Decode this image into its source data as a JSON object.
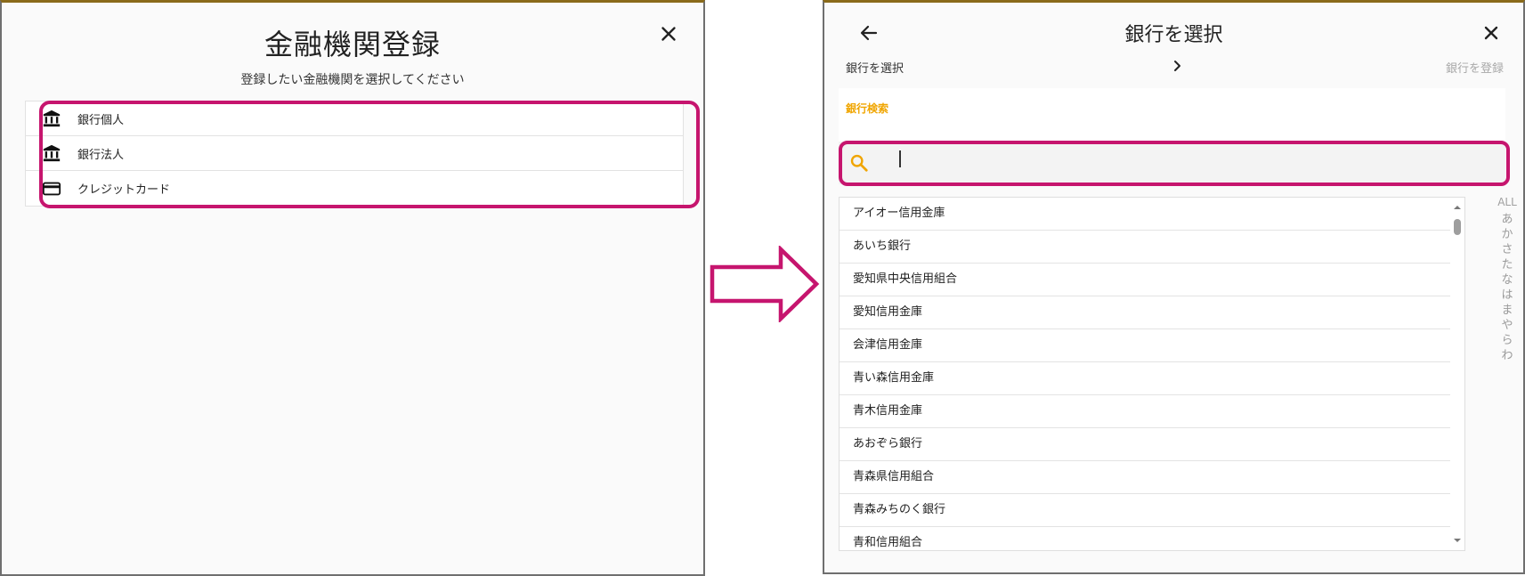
{
  "left": {
    "title": "金融機関登録",
    "subtitle": "登録したい金融機関を選択してください",
    "close_icon": "close-icon",
    "items": [
      {
        "label": "銀行個人",
        "icon": "bank-icon"
      },
      {
        "label": "銀行法人",
        "icon": "bank-icon"
      },
      {
        "label": "クレジットカード",
        "icon": "credit-card-icon"
      }
    ]
  },
  "right": {
    "title": "銀行を選択",
    "back_icon": "arrow-left-icon",
    "close_icon": "close-icon",
    "stepper": {
      "current": "銀行を選択",
      "next": "銀行を登録"
    },
    "search": {
      "label": "銀行検索",
      "value": "",
      "placeholder": ""
    },
    "banks": [
      "アイオー信用金庫",
      "あいち銀行",
      "愛知県中央信用組合",
      "愛知信用金庫",
      "会津信用金庫",
      "青い森信用金庫",
      "青木信用金庫",
      "あおぞら銀行",
      "青森県信用組合",
      "青森みちのく銀行",
      "青和信用組合"
    ],
    "kana_index": [
      "ALL",
      "あ",
      "か",
      "さ",
      "た",
      "な",
      "は",
      "ま",
      "や",
      "ら",
      "わ"
    ]
  },
  "colors": {
    "highlight": "#c6156e",
    "accent": "#f0a500",
    "window_top_border": "#8a6a1a"
  }
}
